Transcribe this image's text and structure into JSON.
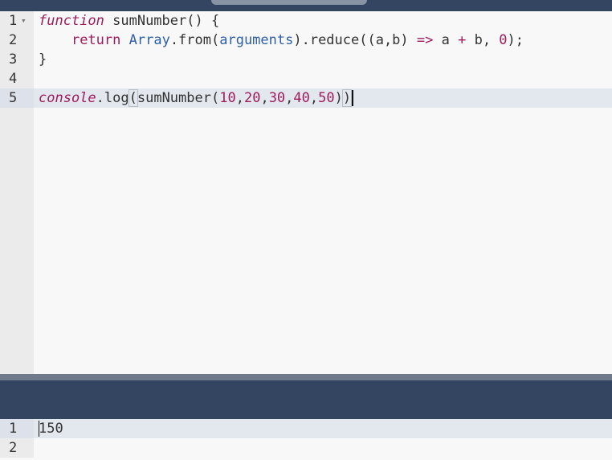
{
  "editor": {
    "lines": [
      {
        "number": "1",
        "fold": "▾",
        "tokens": {
          "t1": "function",
          "t2": " sumNumber() {"
        }
      },
      {
        "number": "2",
        "tokens": {
          "t1": "    ",
          "t2": "return",
          "t3": " ",
          "t4": "Array",
          "t5": ".from(",
          "t6": "arguments",
          "t7": ").reduce((a,b) ",
          "t8": "=>",
          "t9": " a ",
          "t10": "+",
          "t11": " b, ",
          "t12": "0",
          "t13": ");"
        }
      },
      {
        "number": "3",
        "tokens": {
          "t1": "}"
        }
      },
      {
        "number": "4",
        "tokens": {}
      },
      {
        "number": "5",
        "tokens": {
          "t1": "console",
          "t2": ".log",
          "t3": "(",
          "t4": "sumNumber(",
          "t5": "10",
          "t6": ",",
          "t7": "20",
          "t8": ",",
          "t9": "30",
          "t10": ",",
          "t11": "40",
          "t12": ",",
          "t13": "50",
          "t14": ")",
          "t15": ")"
        }
      }
    ]
  },
  "console": {
    "lines": [
      {
        "number": "1",
        "text": "150"
      },
      {
        "number": "2",
        "text": ""
      }
    ]
  },
  "colors": {
    "keyword": "#9e1c5c",
    "builtin": "#2f5fa8",
    "header": "#334561"
  }
}
